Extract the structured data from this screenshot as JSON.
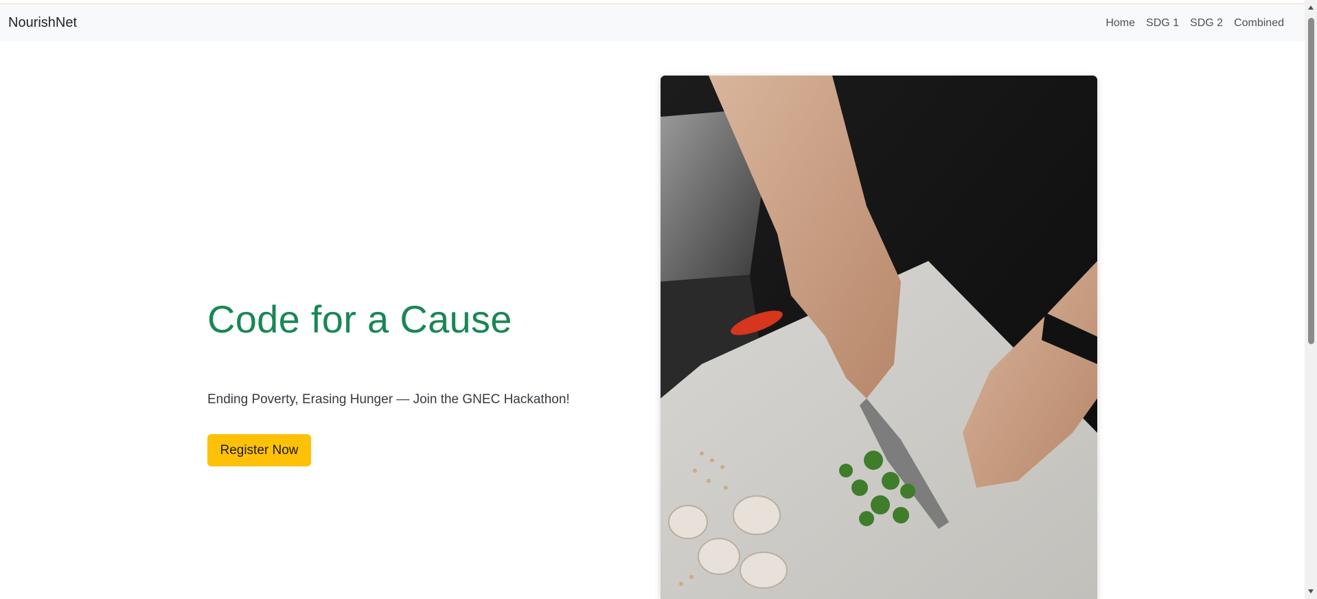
{
  "navbar": {
    "brand": "NourishNet",
    "links": [
      "Home",
      "SDG 1",
      "SDG 2",
      "Combined"
    ]
  },
  "hero": {
    "title": "Code for a Cause",
    "subtitle": "Ending Poverty, Erasing Hunger — Join the GNEC Hackathon!",
    "button_label": "Register Now"
  },
  "colors": {
    "title": "#198754",
    "button": "#ffc107",
    "navbar_bg": "#f8f9fa"
  }
}
